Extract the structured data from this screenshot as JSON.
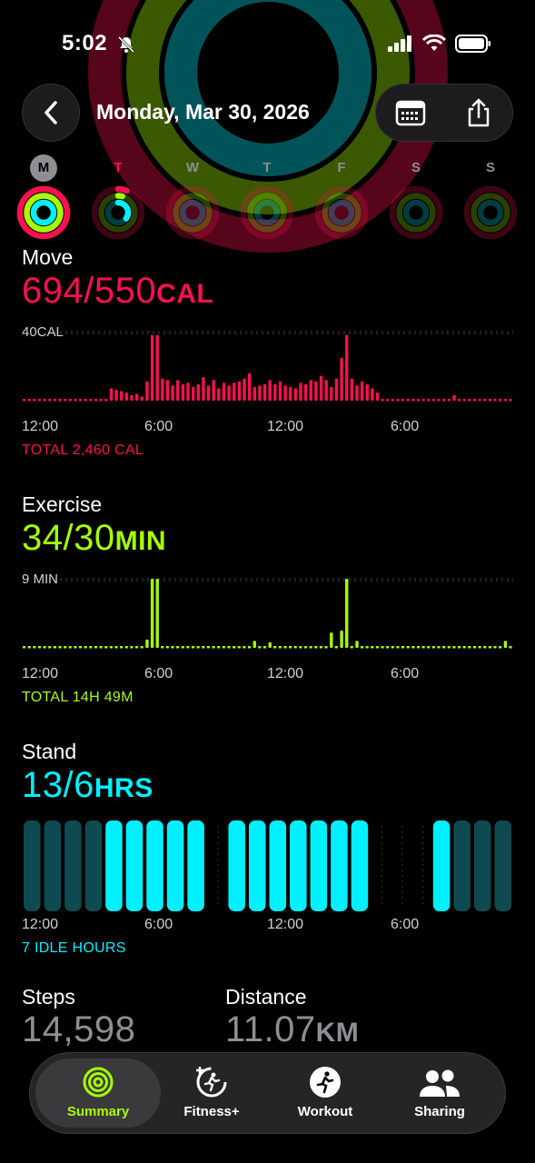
{
  "status": {
    "time": "5:02"
  },
  "nav": {
    "title": "Monday, Mar 30, 2026"
  },
  "week": [
    {
      "letter": "M",
      "today": true
    },
    {
      "letter": "T"
    },
    {
      "letter": "W"
    },
    {
      "letter": "T"
    },
    {
      "letter": "F"
    },
    {
      "letter": "S"
    },
    {
      "letter": "S"
    }
  ],
  "colors": {
    "move": "#fa114f",
    "exercise": "#a6ff00",
    "stand": "#00f0ff",
    "stand_dim": "#0e4a4f"
  },
  "move": {
    "title": "Move",
    "value": "694/550",
    "unit": "CAL",
    "ymax": "40CAL",
    "axis": [
      "12:00",
      "6:00",
      "12:00",
      "6:00"
    ],
    "total": "TOTAL 2,460 CAL"
  },
  "exercise": {
    "title": "Exercise",
    "value": "34/30",
    "unit": "MIN",
    "ymax": "9 MIN",
    "axis": [
      "12:00",
      "6:00",
      "12:00",
      "6:00"
    ],
    "total": "TOTAL 14H 49M"
  },
  "stand": {
    "title": "Stand",
    "value": "13/6",
    "unit": "HRS",
    "axis": [
      "12:00",
      "6:00",
      "12:00",
      "6:00"
    ],
    "total": "7 IDLE HOURS"
  },
  "steps": {
    "title": "Steps",
    "value": "14,598"
  },
  "distance": {
    "title": "Distance",
    "value": "11.07",
    "unit": "KM"
  },
  "tabs": [
    {
      "label": "Summary",
      "active": true,
      "icon": "activity-rings-icon"
    },
    {
      "label": "Fitness+",
      "icon": "fitness-plus-icon"
    },
    {
      "label": "Workout",
      "icon": "workout-icon"
    },
    {
      "label": "Sharing",
      "icon": "sharing-icon"
    }
  ]
}
